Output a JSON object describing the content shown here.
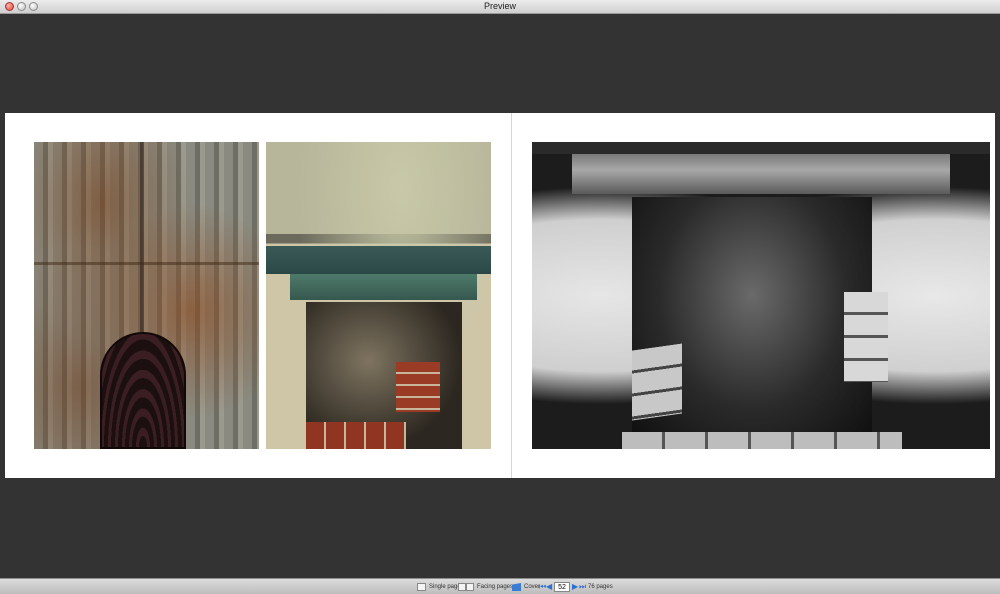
{
  "window": {
    "title": "Preview"
  },
  "photos": [
    {
      "name": "rusted-iron-photo"
    },
    {
      "name": "fireplace-color-photo"
    },
    {
      "name": "fireplace-bw-photo"
    }
  ],
  "statusbar": {
    "single_pages_label": "Single pages",
    "facing_pages_label": "Facing pages",
    "cover_label": "Cover",
    "current_page": "52",
    "page_count_label": "76 pages"
  },
  "icons": {
    "first": "first-page-icon",
    "prev": "previous-page-icon",
    "next": "next-page-icon",
    "last": "last-page-icon"
  },
  "colors": {
    "accent": "#2d6fd0",
    "background": "#333333"
  }
}
